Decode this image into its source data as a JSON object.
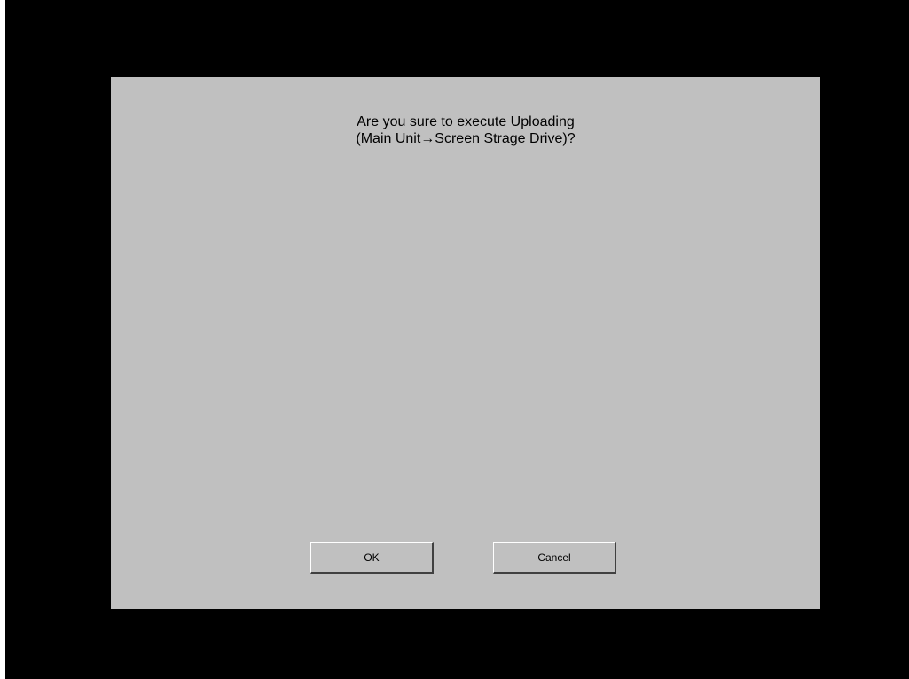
{
  "dialog": {
    "message_line1": "Are you sure to execute Uploading",
    "message_line2": "(Main Unit→Screen Strage Drive)?",
    "ok_label": "OK",
    "cancel_label": "Cancel"
  },
  "colors": {
    "background": "#000000",
    "dialog": "#c0c0c0",
    "text": "#000000"
  }
}
